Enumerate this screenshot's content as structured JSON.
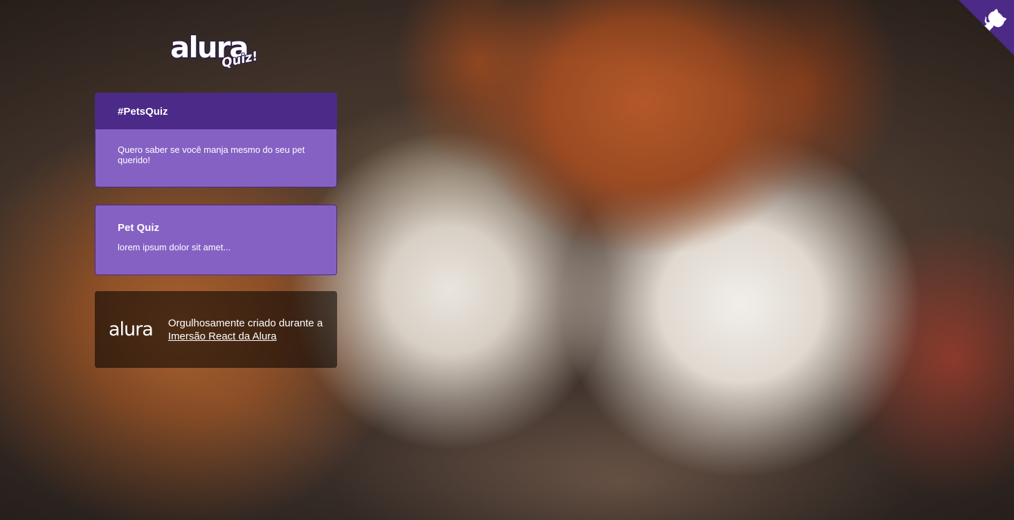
{
  "logo": {
    "word": "alura",
    "sub": "Quiz!"
  },
  "main_widget": {
    "title": "#PetsQuiz",
    "description": "Quero saber se você manja mesmo do seu pet querido!"
  },
  "quiz_widget": {
    "title": "Pet Quiz",
    "description": "lorem ipsum dolor sit amet..."
  },
  "footer": {
    "logo_text": "alura",
    "text_prefix": "Orgulhosamente criado durante a ",
    "link_text": "Imersão React da Alura"
  },
  "github_corner": {
    "icon": "github-octocat-icon"
  },
  "colors": {
    "primary": "#4b2a88",
    "secondary": "#8561c4",
    "footer_bg": "rgba(0,0,0,0.55)",
    "contrast_text": "#ffffff"
  }
}
